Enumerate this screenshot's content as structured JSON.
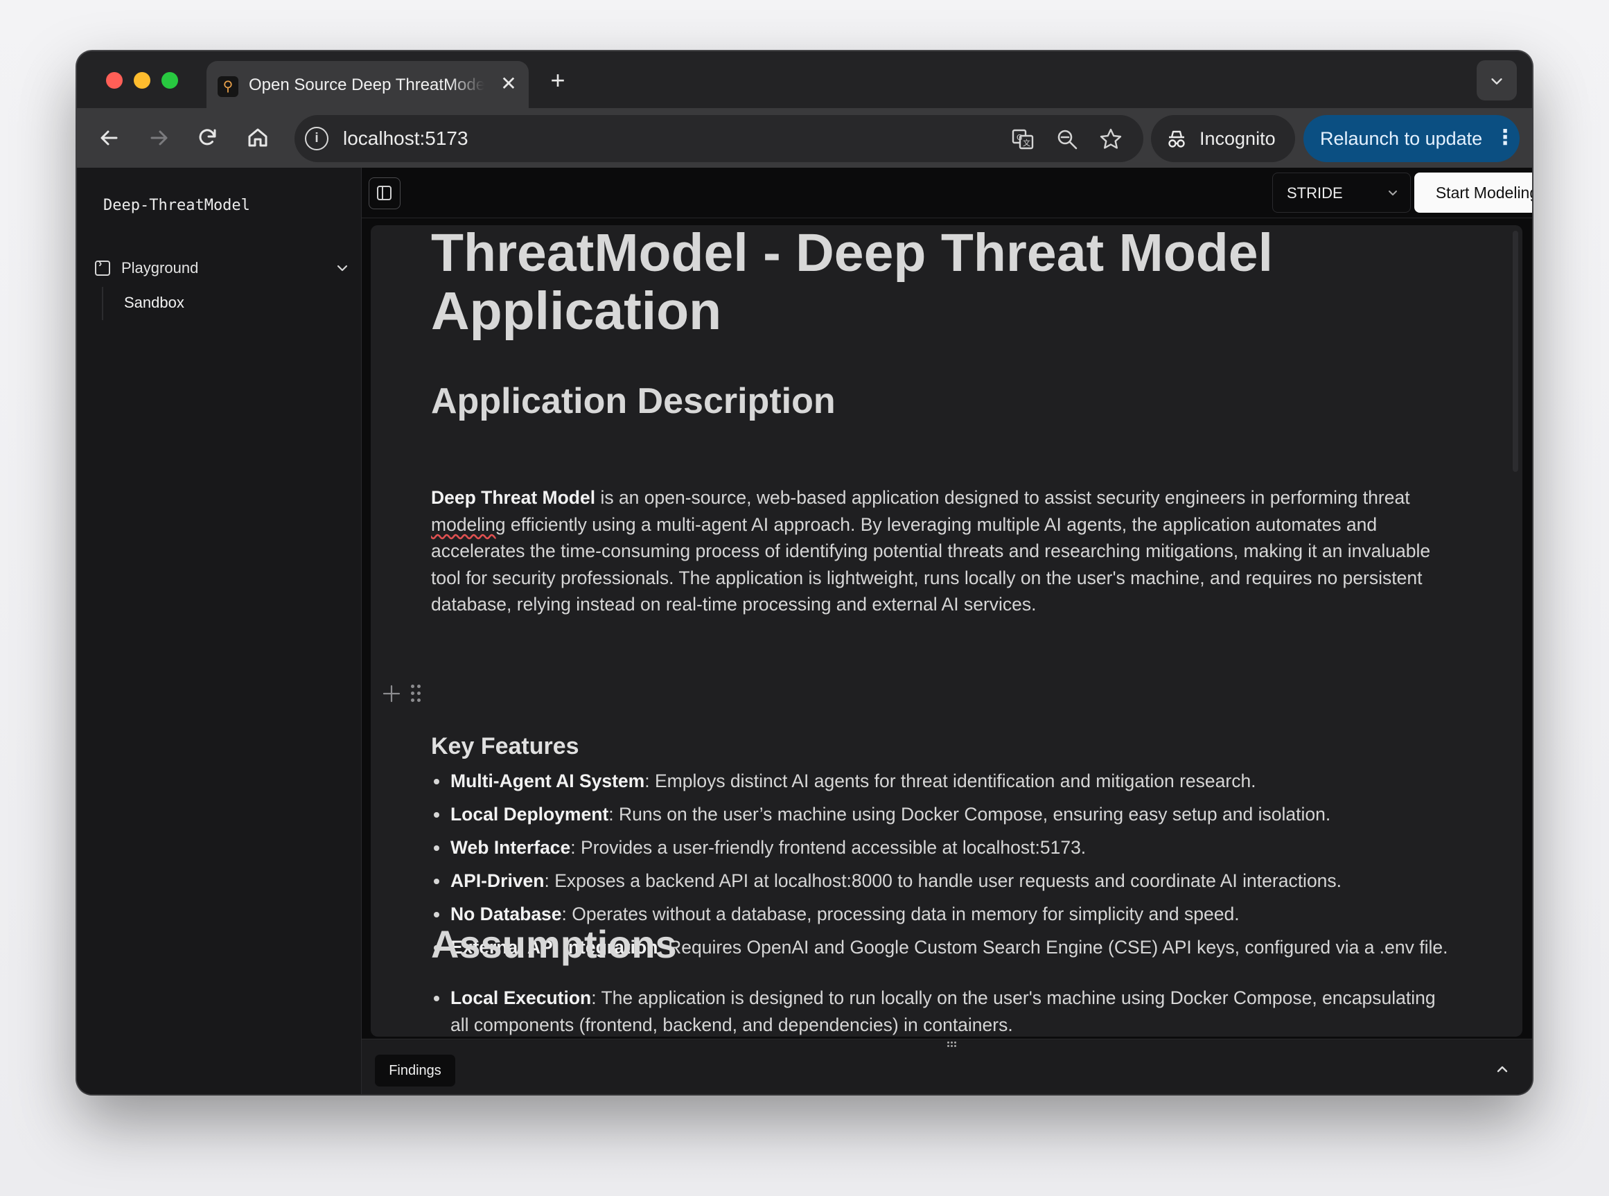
{
  "browser": {
    "tab_title": "Open Source Deep ThreatModel",
    "tab_close": "✕",
    "new_tab": "+",
    "url": "localhost:5173",
    "incognito_label": "Incognito",
    "relaunch_label": "Relaunch to update"
  },
  "sidebar": {
    "brand": "Deep-ThreatModel",
    "group_label": "Playground",
    "items": [
      {
        "label": "Sandbox"
      }
    ]
  },
  "topbar": {
    "framework_select": "STRIDE",
    "start_button": "Start Modeling"
  },
  "document": {
    "title": "ThreatModel - Deep Threat Model Application",
    "section1_heading": "Application Description",
    "description": {
      "lead_bold": "Deep Threat Model",
      "text_a": " is an open-source, web-based application designed to assist security engineers in performing threat ",
      "spell_word": "modeling",
      "text_b": " efficiently using a multi-agent AI approach. By leveraging multiple AI agents, the application automates and accelerates the time-consuming process of identifying potential threats and researching mitigations, making it an invaluable tool for security professionals. The application is lightweight, runs locally on the user's machine, and requires no persistent database, relying instead on real-time processing and external AI services."
    },
    "features_heading": "Key Features",
    "features": [
      {
        "name": "Multi-Agent AI System",
        "text": ": Employs distinct AI agents for threat identification and mitigation research."
      },
      {
        "name": "Local Deployment",
        "text": ": Runs on the user’s machine using Docker Compose, ensuring easy setup and isolation."
      },
      {
        "name": "Web Interface",
        "text": ": Provides a user-friendly frontend accessible at localhost:5173."
      },
      {
        "name": "API-Driven",
        "text": ": Exposes a backend API at localhost:8000 to handle user requests and coordinate AI interactions."
      },
      {
        "name": "No Database",
        "text": ": Operates without a database, processing data in memory for simplicity and speed."
      },
      {
        "name": "External API Integration",
        "text": ": Requires OpenAI and Google Custom Search Engine (CSE) API keys, configured via a .env file."
      }
    ],
    "assumptions_heading": "Assumptions",
    "assumptions": [
      {
        "name": "Local Execution",
        "text": ": The application is designed to run locally on the user's machine using Docker Compose, encapsulating all components (frontend, backend, and dependencies) in containers."
      }
    ]
  },
  "bottom_panel": {
    "findings_tab": "Findings"
  },
  "icons": {
    "back": "arrow-left-icon",
    "forward": "arrow-right-icon",
    "reload": "reload-icon",
    "home": "home-icon",
    "site_info": "info-icon",
    "translate": "translate-icon",
    "zoom": "zoom-icon",
    "bookmark": "star-icon",
    "theme": "sun-icon"
  },
  "colors": {
    "relaunch_bg": "#0b4f82",
    "traffic_red": "#ff5f57",
    "traffic_yellow": "#febc2e",
    "traffic_green": "#28c840"
  }
}
